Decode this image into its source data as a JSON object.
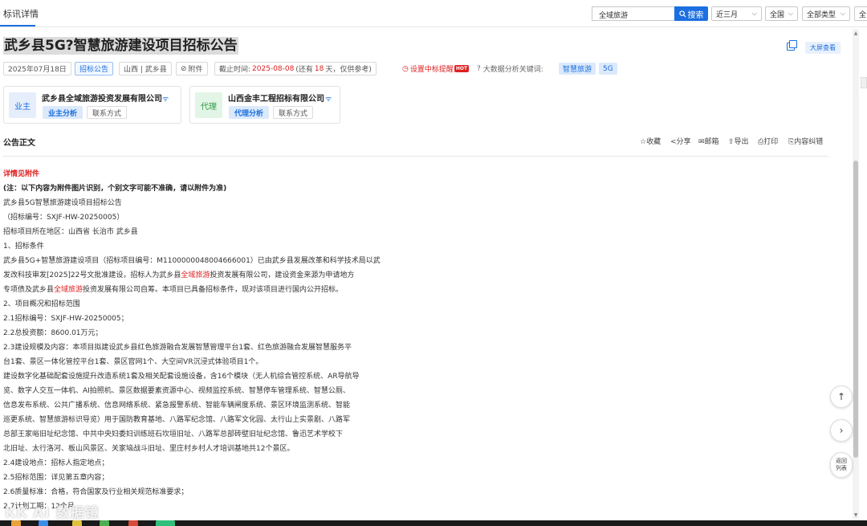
{
  "header": {
    "tab_title": "标讯详情",
    "search_value": "全域旅游",
    "search_button": "搜索",
    "filters": [
      "近三月",
      "全国",
      "全部类型",
      "全"
    ]
  },
  "announcement": {
    "title": "武乡县5G?智慧旅游建设项目招标公告",
    "bigscreen_button": "大屏查看",
    "date": "2025年07月18日",
    "type": "招标公告",
    "region": "山西 | 武乡县",
    "attachment": "附件",
    "deadline_prefix": "截止时间:",
    "deadline_date": "2025-08-08",
    "deadline_remain_prefix": "(还有",
    "deadline_days": "18",
    "deadline_remain_suffix": "天，仅供参考)",
    "alert_label": "设置中标提醒",
    "hot_badge": "HOT",
    "keywords_label": "大数据分析关键词:",
    "keywords": [
      "智慧旅游",
      "5G"
    ]
  },
  "parties": [
    {
      "role": "业主",
      "name": "武乡县全域旅游投资发展有限公司",
      "analysis": "业主分析",
      "contact": "联系方式"
    },
    {
      "role": "代理",
      "name": "山西金丰工程招标有限公司",
      "analysis": "代理分析",
      "contact": "联系方式"
    }
  ],
  "section": {
    "title": "公告正文",
    "actions": [
      "收藏",
      "分享",
      "邮箱",
      "导出",
      "打印",
      "内容纠错"
    ]
  },
  "body": {
    "see_attachment": "详情见附件",
    "note": "(注：以下内容为附件图片识别，个别文字可能不准确，请以附件为准)",
    "lines": [
      "武乡县5G智慧旅游建设项目招标公告",
      "（招标编号：SXJF-HW-20250005）",
      "招标项目所在地区：山西省 长治市 武乡县",
      "1、招标条件",
      "武乡县5G+智慧旅游建设项目（招标项目编号：M1100000048004666001）已由武乡县发展改革和科学技术局以武",
      "发改科技审发[2025]22号文批准建设，招标人为武乡县",
      "全域旅游",
      "投资发展有限公司，建设资金来源为申请地方",
      "专项债及武乡县",
      "全域旅游",
      "投资发展有限公司自筹。本项目已具备招标条件，现对该项目进行国内公开招标。",
      "2、项目概况和招标范围",
      "2.1招标编号：SXJF-HW-20250005；",
      "2.2总投资额：8600.01万元；",
      "2.3建设规模及内容：本项目拟建设武乡县红色旅游融合发展智慧管理平台1套、红色旅游融合发展智慧服务平",
      "台1套、景区一体化管控平台1套、景区官网1个、大空间VR沉浸式体验项目1个。",
      "建设数字化基础配套设施提升改造系统1套及相关配套设施设备，含16个模块（无人机综合管控系统、AR导航导",
      "览、数字人交互一体机、AI拍照机、景区数据要素资源中心、视频监控系统、智慧停车管理系统、智慧公厕、",
      "信息发布系统、公共广播系统、信息网络系统、紧急报警系统、智能车辆闸度系统、景区环境监测系统、智能",
      "巡更系统、智慧旅游标识导览）用于国防教育基地、八路军纪念馆、八路军文化园、太行山上实景剧、八路军",
      "总部王家峪旧址纪念馆、中共中央妇委妇训练班石坎垣旧址、八路军总部砖壁旧址纪念馆、鲁迅艺术学校下",
      "北旧址、太行洛河、板山风景区、关家垴战斗旧址、里庄村乡村人才培训基地共12个景区。",
      "2.4建设地点：招标人指定地点；",
      "2.5招标范围：详见第五章内容；",
      "2.6质量标准：合格，符合国家及行业相关规范标准要求；",
      "2.7计划工期：12个月"
    ]
  },
  "floating": {
    "back_label_1": "返回",
    "back_label_2": "列表"
  },
  "watermark": "KK AI 数据镜",
  "colors": {
    "accent": "#1b6fe0",
    "highlight_red": "#e02020"
  }
}
